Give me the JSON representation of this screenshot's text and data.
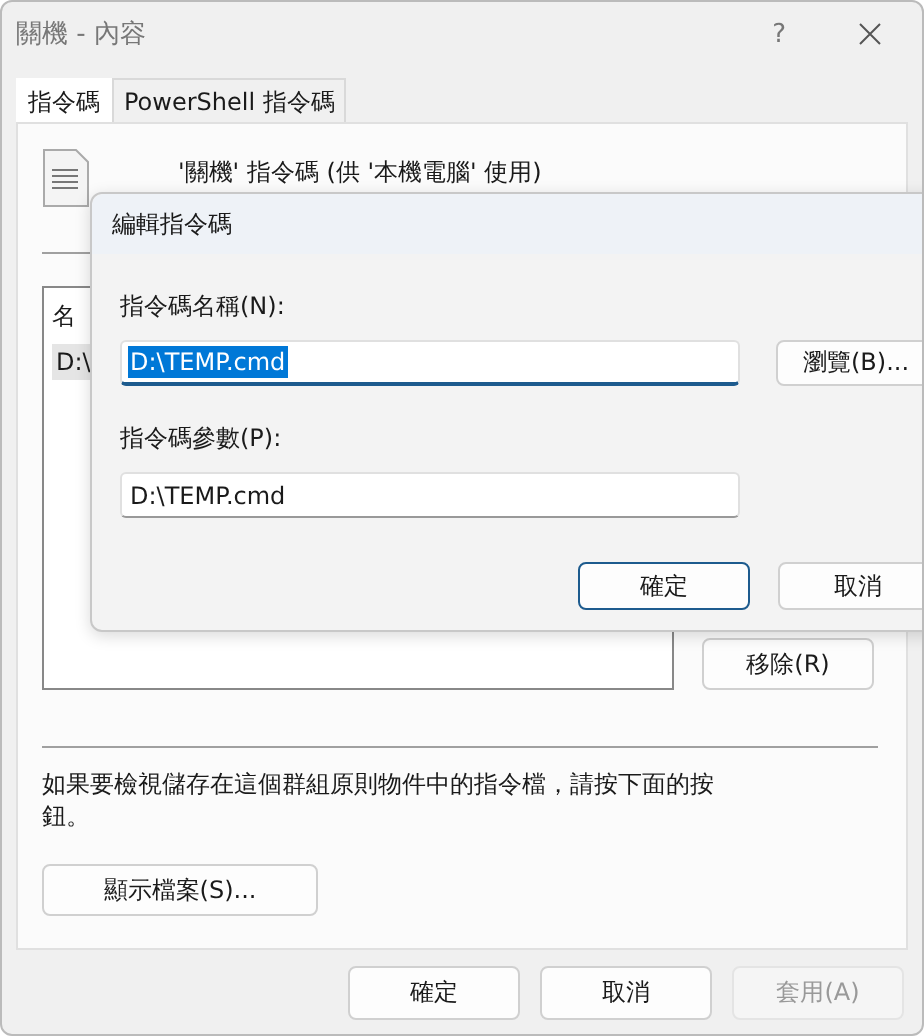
{
  "window": {
    "title": "關機 - 內容",
    "help": "?"
  },
  "tabs": [
    {
      "label": "指令碼",
      "selected": true
    },
    {
      "label": "PowerShell 指令碼",
      "selected": false
    }
  ],
  "panel": {
    "header": "'關機' 指令碼 (供 '本機電腦' 使用)",
    "list": {
      "columns": [
        "名"
      ],
      "rows": [
        {
          "cells": [
            "D:\\"
          ],
          "selected": true
        }
      ]
    },
    "side_buttons": [
      "移除(R)"
    ],
    "note": "如果要檢視儲存在這個群組原則物件中的指令檔，請按下面的按鈕。",
    "show_files_button": "顯示檔案(S)..."
  },
  "buttons": [
    {
      "label": "確定",
      "disabled": false
    },
    {
      "label": "取消",
      "disabled": false
    },
    {
      "label": "套用(A)",
      "disabled": true
    }
  ],
  "edit_dialog": {
    "title": "編輯指令碼",
    "name_label": "指令碼名稱(N):",
    "name_value": "D:\\TEMP.cmd",
    "name_selected": true,
    "browse_button": "瀏覽(B)...",
    "params_label": "指令碼參數(P):",
    "params_value": "D:\\TEMP.cmd",
    "ok_button": "確定",
    "cancel_button": "取消"
  }
}
